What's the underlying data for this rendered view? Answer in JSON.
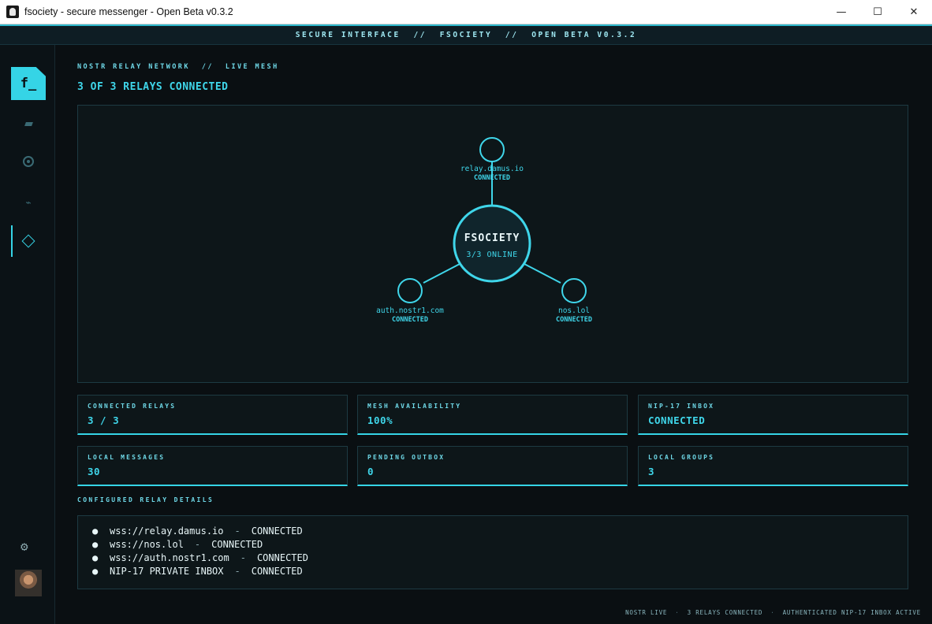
{
  "window": {
    "title": "fsociety - secure messenger - Open Beta v0.3.2",
    "minimize": "—",
    "maximize": "☐",
    "close": "✕"
  },
  "banner": {
    "text": "SECURE INTERFACE  //  FSOCIETY  //  OPEN BETA V0.3.2"
  },
  "sidebar": {
    "logo": "f_",
    "items": [
      {
        "icon": "chat-icon"
      },
      {
        "icon": "target-icon"
      },
      {
        "icon": "activity-icon"
      },
      {
        "icon": "diamond-icon",
        "active": true
      }
    ],
    "settings_icon": "gear-icon",
    "avatar": "user-avatar"
  },
  "main": {
    "subtitle": "NOSTR RELAY NETWORK  //  LIVE MESH",
    "headline": "3 OF 3 RELAYS CONNECTED",
    "graph": {
      "center_title": "FSOCIETY",
      "center_status": "3/3 ONLINE",
      "relays": [
        {
          "name": "relay.damus.io",
          "status": "CONNECTED"
        },
        {
          "name": "auth.nostr1.com",
          "status": "CONNECTED"
        },
        {
          "name": "nos.lol",
          "status": "CONNECTED"
        }
      ]
    },
    "stats": [
      {
        "label": "CONNECTED RELAYS",
        "value": "3 / 3"
      },
      {
        "label": "MESH AVAILABILITY",
        "value": "100%"
      },
      {
        "label": "NIP-17 INBOX",
        "value": "CONNECTED"
      },
      {
        "label": "LOCAL MESSAGES",
        "value": "30"
      },
      {
        "label": "PENDING OUTBOX",
        "value": "0"
      },
      {
        "label": "LOCAL GROUPS",
        "value": "3"
      }
    ],
    "details_title": "CONFIGURED RELAY DETAILS",
    "details": [
      {
        "name": "wss://relay.damus.io",
        "status": "CONNECTED"
      },
      {
        "name": "wss://nos.lol",
        "status": "CONNECTED"
      },
      {
        "name": "wss://auth.nostr1.com",
        "status": "CONNECTED"
      },
      {
        "name": "NIP-17 PRIVATE INBOX",
        "status": "CONNECTED"
      }
    ]
  },
  "footer": {
    "items": [
      "NOSTR LIVE",
      "3 RELAYS CONNECTED",
      "AUTHENTICATED NIP-17 INBOX ACTIVE"
    ]
  },
  "colors": {
    "accent": "#35d4e6",
    "background": "#0a0f12",
    "panel": "#0d1619"
  }
}
